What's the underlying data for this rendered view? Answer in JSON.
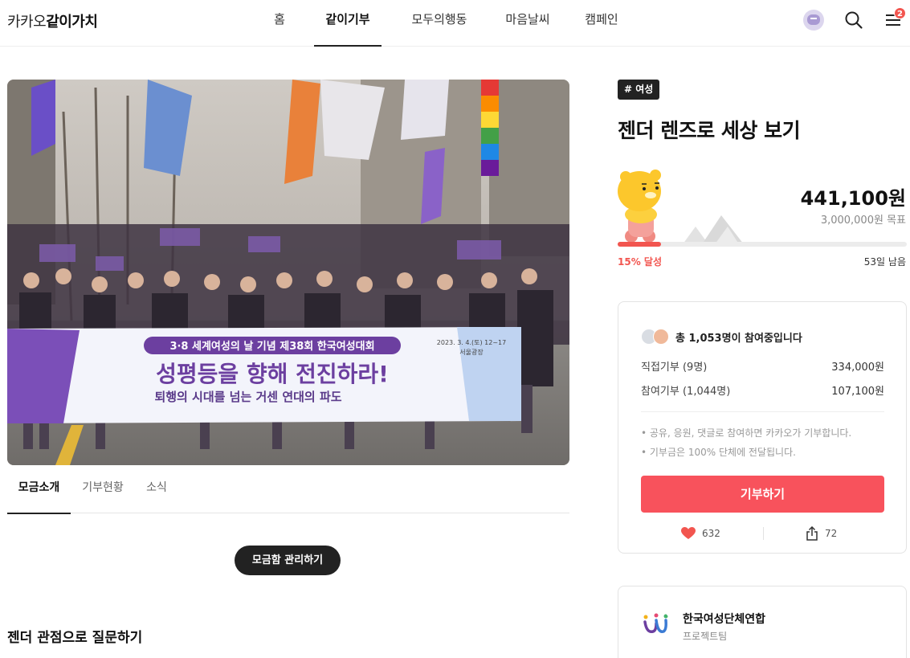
{
  "header": {
    "brand_light": "카카오",
    "brand_bold": "같이가치",
    "nav": [
      {
        "label": "홈",
        "active": false
      },
      {
        "label": "같이기부",
        "active": true
      },
      {
        "label": "모두의행동",
        "active": false
      },
      {
        "label": "마음날씨",
        "active": false
      },
      {
        "label": "캠페인",
        "active": false
      }
    ],
    "notification_count": "2",
    "icons": [
      "avatar",
      "search-icon",
      "menu-icon"
    ]
  },
  "hero": {
    "banner_line1": "3·8 세계여성의 날 기념 제38회 한국여성대회",
    "banner_line2": "성평등을 향해 전진하라!",
    "banner_line3": "퇴행의 시대를 넘는 거센 연대의 파도",
    "banner_date": "2023. 3. 4.(토) 12~17",
    "banner_place": "서울광장"
  },
  "tabs": [
    {
      "label": "모금소개",
      "active": true
    },
    {
      "label": "기부현황",
      "active": false
    },
    {
      "label": "소식",
      "active": false
    }
  ],
  "manage_button": "모금함 관리하기",
  "section_heading": "젠더 관점으로 질문하기",
  "campaign": {
    "tag": "# 여성",
    "title": "젠더 렌즈로 세상 보기",
    "amount": "441,100원",
    "goal": "3,000,000원 목표",
    "progress_percent": 15,
    "progress_label": "15% 달성",
    "days_left": "53일 남음"
  },
  "donation_card": {
    "participants_text": "총 1,053명이 참여중입니다",
    "direct_label": "직접기부 (9명)",
    "direct_value": "334,000원",
    "participation_label": "참여기부 (1,044명)",
    "participation_value": "107,100원",
    "note1": "• 공유, 응원, 댓글로 참여하면 카카오가 기부합니다.",
    "note2": "• 기부금은 100% 단체에 전달됩니다.",
    "donate_button": "기부하기",
    "likes": "632",
    "shares": "72"
  },
  "organization": {
    "name": "한국여성단체연합",
    "subtitle": "프로젝트팀"
  },
  "colors": {
    "accent": "#f8525c",
    "progress": "#f2554f",
    "banner_purple": "#6c3fa0",
    "dark": "#222222"
  }
}
